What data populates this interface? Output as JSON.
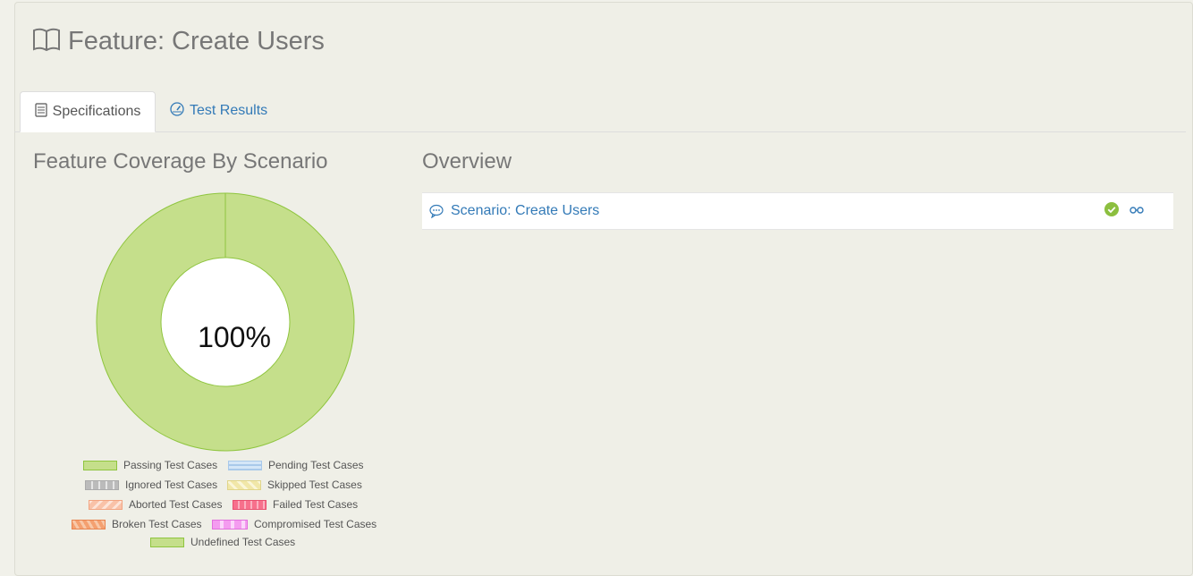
{
  "page": {
    "title": "Feature: Create Users"
  },
  "tabs": [
    {
      "label": "Specifications",
      "icon": "document-list-icon",
      "active": true
    },
    {
      "label": "Test Results",
      "icon": "dashboard-gauge-icon",
      "active": false
    }
  ],
  "coverage": {
    "heading": "Feature Coverage By Scenario",
    "center_label": "100%"
  },
  "chart_data": {
    "type": "pie",
    "title": "",
    "labels": [
      "Passing Test Cases",
      "Pending Test Cases",
      "Ignored Test Cases",
      "Skipped Test Cases",
      "Aborted Test Cases",
      "Failed Test Cases",
      "Broken Test Cases",
      "Compromised Test Cases",
      "Undefined Test Cases"
    ],
    "values": [
      100,
      0,
      0,
      0,
      0,
      0,
      0,
      0,
      0
    ],
    "donut": true,
    "center_text": "100%",
    "legend_position": "bottom",
    "colors": [
      "#c5df8b",
      "#bcd6ef",
      "#c8c8c8",
      "#f1e7a8",
      "#f9c2a8",
      "#f7708c",
      "#f4a070",
      "#f49cf0",
      "#c5df8b"
    ]
  },
  "legend": [
    {
      "label": "Passing Test Cases",
      "swatch": "passing"
    },
    {
      "label": "Pending Test Cases",
      "swatch": "pending"
    },
    {
      "label": "Ignored Test Cases",
      "swatch": "ignored"
    },
    {
      "label": "Skipped Test Cases",
      "swatch": "skipped"
    },
    {
      "label": "Aborted Test Cases",
      "swatch": "aborted"
    },
    {
      "label": "Failed Test Cases",
      "swatch": "failed"
    },
    {
      "label": "Broken Test Cases",
      "swatch": "broken"
    },
    {
      "label": "Compromised Test Cases",
      "swatch": "compromised"
    },
    {
      "label": "Undefined Test Cases",
      "swatch": "undefined"
    }
  ],
  "overview": {
    "heading": "Overview",
    "scenarios": [
      {
        "label": "Scenario: Create Users",
        "status": "passed",
        "status_icon": "check-circle-icon",
        "extra_icon": "glasses-icon"
      }
    ]
  },
  "colors": {
    "link": "#337ab7",
    "passing": "#c5df8b",
    "passing_stroke": "#8fc53f",
    "status_ok": "#8cbf3f"
  }
}
